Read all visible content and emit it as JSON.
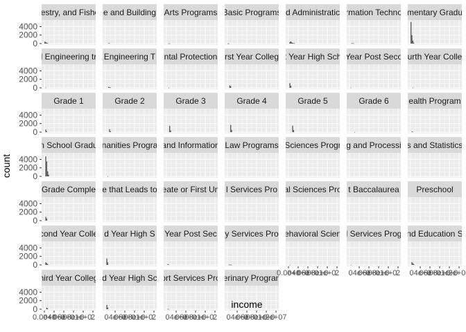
{
  "chart_data": {
    "type": "bar",
    "subtype": "faceted-histogram",
    "xlabel": "income",
    "ylabel": "count",
    "y_ticks": [
      "0",
      "2000",
      "4000"
    ],
    "ylim": [
      0,
      5200
    ],
    "x_tick_fragments": {
      "row6": [
        "0.0e+0",
        "04e+0",
        "06e+0",
        "08e+0",
        "1e+0",
        "2"
      ],
      "row6_last": [
        "0.0e+0",
        "04e+0",
        "06e+0",
        "08e+0",
        "1e+0",
        "2e+07"
      ],
      "row7_first": [
        "0.0e+0",
        "04e+0",
        "06e+0",
        "08e+0",
        "1e+0",
        "2"
      ],
      "row7_mid": [
        "04e+0",
        "06e+0",
        "08e+0",
        "1e+0",
        "2"
      ],
      "row7_last": [
        "04e+0",
        "06e+0",
        "08e+0",
        "1e+0",
        "2e+07"
      ]
    },
    "grid": true,
    "panel_background": "#ebebeb",
    "strip_background": "#d9d9d9",
    "bar_color": "#595959",
    "bin_width_fraction": 0.016,
    "panels": [
      {
        "label": "restry, and Fishe",
        "bins": [
          {
            "bin": 1,
            "count": 450
          },
          {
            "bin": 2,
            "count": 320
          },
          {
            "bin": 3,
            "count": 200
          },
          {
            "bin": 4,
            "count": 80
          }
        ]
      },
      {
        "label": "e and Building",
        "bins": [
          {
            "bin": 4,
            "count": 100
          },
          {
            "bin": 5,
            "count": 60
          }
        ]
      },
      {
        "label": "Arts Programs",
        "bins": [
          {
            "bin": 3,
            "count": 40
          },
          {
            "bin": 4,
            "count": 30
          }
        ]
      },
      {
        "label": "Basic Programs",
        "bins": [
          {
            "bin": 1,
            "count": 40
          },
          {
            "bin": 2,
            "count": 20
          }
        ]
      },
      {
        "label": "d Administratic",
        "bins": [
          {
            "bin": 2,
            "count": 380
          },
          {
            "bin": 3,
            "count": 480
          },
          {
            "bin": 4,
            "count": 280
          },
          {
            "bin": 5,
            "count": 150
          },
          {
            "bin": 6,
            "count": 100
          },
          {
            "bin": 7,
            "count": 60
          }
        ]
      },
      {
        "label": "rmation Techno",
        "bins": [
          {
            "bin": 3,
            "count": 80
          },
          {
            "bin": 4,
            "count": 80
          },
          {
            "bin": 5,
            "count": 60
          }
        ]
      },
      {
        "label": "mentary Gradu",
        "bins": [
          {
            "bin": 1,
            "count": 5100
          },
          {
            "bin": 2,
            "count": 2000
          },
          {
            "bin": 3,
            "count": 700
          },
          {
            "bin": 4,
            "count": 200
          }
        ]
      },
      {
        "label": "l Engineering tr",
        "bins": [
          {
            "bin": 2,
            "count": 60
          }
        ]
      },
      {
        "label": "Engineering T",
        "bins": [
          {
            "bin": 4,
            "count": 220
          },
          {
            "bin": 5,
            "count": 160
          },
          {
            "bin": 6,
            "count": 80
          }
        ]
      },
      {
        "label": "ntal Protection",
        "bins": [
          {
            "bin": 3,
            "count": 30
          }
        ]
      },
      {
        "label": "rst Year Colleg",
        "bins": [
          {
            "bin": 3,
            "count": 550
          },
          {
            "bin": 4,
            "count": 400
          }
        ]
      },
      {
        "label": "t Year High Sch",
        "bins": [
          {
            "bin": 2,
            "count": 1100
          },
          {
            "bin": 3,
            "count": 500
          }
        ]
      },
      {
        "label": "Year Post Seco",
        "bins": [
          {
            "bin": 2,
            "count": 50
          }
        ]
      },
      {
        "label": "urth Year Colle",
        "bins": [
          {
            "bin": 3,
            "count": 50
          }
        ]
      },
      {
        "label": "Grade 1",
        "bins": [
          {
            "bin": 2,
            "count": 600
          },
          {
            "bin": 3,
            "count": 200
          }
        ]
      },
      {
        "label": "Grade 2",
        "bins": [
          {
            "bin": 5,
            "count": 700
          },
          {
            "bin": 6,
            "count": 200
          }
        ]
      },
      {
        "label": "Grade 3",
        "bins": [
          {
            "bin": 4,
            "count": 1500
          },
          {
            "bin": 5,
            "count": 400
          }
        ]
      },
      {
        "label": "Grade 4",
        "bins": [
          {
            "bin": 4,
            "count": 1700
          },
          {
            "bin": 5,
            "count": 500
          }
        ]
      },
      {
        "label": "Grade 5",
        "bins": [
          {
            "bin": 5,
            "count": 1500
          },
          {
            "bin": 6,
            "count": 500
          }
        ]
      },
      {
        "label": "Grade 6",
        "bins": [
          {
            "bin": 6,
            "count": 30
          }
        ]
      },
      {
        "label": "ealth Program",
        "bins": [
          {
            "bin": 2,
            "count": 120
          },
          {
            "bin": 3,
            "count": 80
          }
        ]
      },
      {
        "label": "n School Gradu",
        "bins": [
          {
            "bin": 2,
            "count": 4700
          },
          {
            "bin": 3,
            "count": 3500
          },
          {
            "bin": 4,
            "count": 1200
          },
          {
            "bin": 5,
            "count": 400
          }
        ]
      },
      {
        "label": "nanities Progra",
        "bins": [
          {
            "bin": 3,
            "count": 30
          }
        ]
      },
      {
        "label": "and Information",
        "bins": []
      },
      {
        "label": "Law Programs",
        "bins": []
      },
      {
        "label": "Sciences Progr",
        "bins": []
      },
      {
        "label": "g and Processi",
        "bins": []
      },
      {
        "label": "s and Statistics",
        "bins": []
      },
      {
        "label": "Grade Comple",
        "bins": [
          {
            "bin": 2,
            "count": 900
          },
          {
            "bin": 3,
            "count": 500
          }
        ]
      },
      {
        "label": "e that Leads to",
        "bins": []
      },
      {
        "label": "eate or First Un",
        "bins": []
      },
      {
        "label": "l Services Pro",
        "bins": []
      },
      {
        "label": "al Sciences Pro",
        "bins": []
      },
      {
        "label": "t Baccalaurea",
        "bins": []
      },
      {
        "label": "Preschool",
        "bins": []
      },
      {
        "label": "cond Year Colle",
        "bins": [
          {
            "bin": 2,
            "count": 600
          },
          {
            "bin": 3,
            "count": 450
          },
          {
            "bin": 4,
            "count": 200
          }
        ]
      },
      {
        "label": "d Year High S",
        "bins": [
          {
            "bin": 2,
            "count": 1500
          },
          {
            "bin": 3,
            "count": 600
          }
        ]
      },
      {
        "label": "Year Post Sec",
        "bins": [
          {
            "bin": 2,
            "count": 150
          },
          {
            "bin": 3,
            "count": 100
          }
        ]
      },
      {
        "label": "y Services Pro",
        "bins": [
          {
            "bin": 2,
            "count": 60
          },
          {
            "bin": 3,
            "count": 60
          },
          {
            "bin": 4,
            "count": 50
          },
          {
            "bin": 5,
            "count": 40
          }
        ]
      },
      {
        "label": "ehavioral Scien",
        "bins": [
          {
            "bin": 2,
            "count": 30
          }
        ]
      },
      {
        "label": "l Services Prog",
        "bins": [
          {
            "bin": 2,
            "count": 30
          }
        ]
      },
      {
        "label": "nd Education S",
        "bins": [
          {
            "bin": 2,
            "count": 650
          },
          {
            "bin": 3,
            "count": 400
          },
          {
            "bin": 4,
            "count": 200
          }
        ]
      },
      {
        "label": "hird Year Colleg",
        "bins": [
          {
            "bin": 3,
            "count": 350
          },
          {
            "bin": 4,
            "count": 200
          }
        ]
      },
      {
        "label": "d Year High Sc",
        "bins": [
          {
            "bin": 2,
            "count": 1000
          },
          {
            "bin": 3,
            "count": 400
          }
        ]
      },
      {
        "label": "ort Services Pro",
        "bins": [
          {
            "bin": 2,
            "count": 60
          },
          {
            "bin": 3,
            "count": 30
          }
        ]
      },
      {
        "label": "terinary Program",
        "bins": []
      }
    ]
  }
}
